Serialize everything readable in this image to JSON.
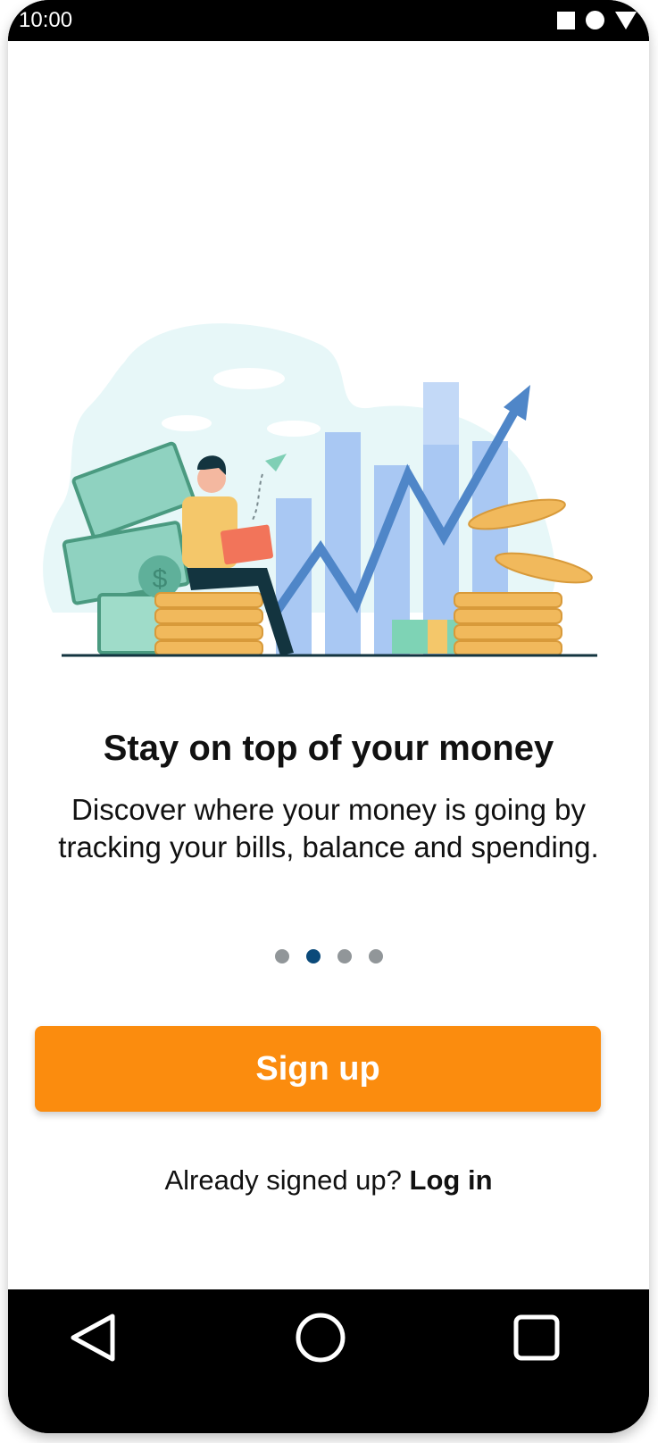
{
  "status_bar": {
    "time": "10:00",
    "icons": [
      "square-icon",
      "circle-icon",
      "triangle-icon"
    ]
  },
  "onboarding": {
    "headline": "Stay on top of your money",
    "description": "Discover where your money is going by tracking your bills, balance and spending.",
    "page_indicator": {
      "count": 4,
      "active_index": 1
    }
  },
  "actions": {
    "signup_label": "Sign up",
    "login_prompt": "Already signed up?",
    "login_label": "Log in"
  },
  "nav_bar": {
    "icons": [
      "back-triangle-icon",
      "home-circle-icon",
      "recents-square-icon"
    ]
  },
  "colors": {
    "accent": "#fb8c0e",
    "active_dot": "#0b4a7a",
    "inactive_dot": "#919699"
  }
}
